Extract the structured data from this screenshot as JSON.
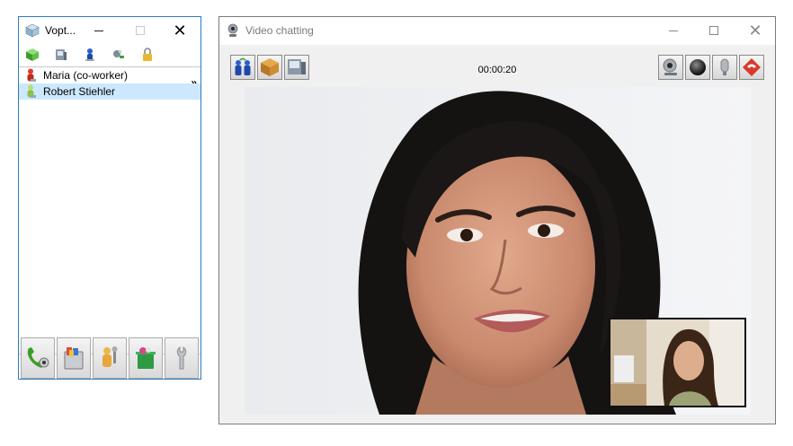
{
  "contacts_window": {
    "title": "Vopt...",
    "more_glyph": "»",
    "contacts": [
      {
        "name": "Maria (co-worker)",
        "selected": false,
        "icon": "person-red-icon"
      },
      {
        "name": "Robert Stiehler",
        "selected": true,
        "icon": "person-green-icon"
      }
    ]
  },
  "video_window": {
    "title": "Video chatting",
    "timer": "00:00:20"
  },
  "colors": {
    "active_border": "#2b7bbf",
    "selection": "#cce8ff",
    "inactive_title": "#7a7a7a"
  }
}
